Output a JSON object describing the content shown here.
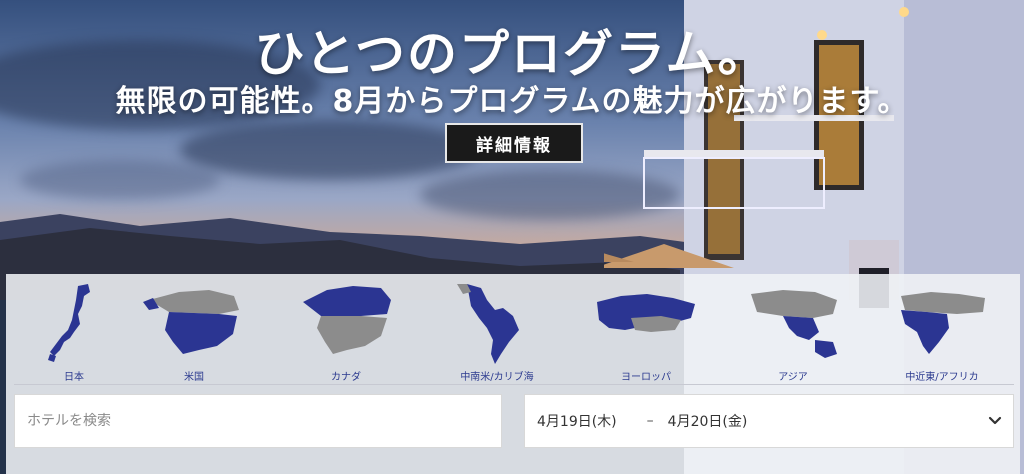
{
  "hero": {
    "headline": "ひとつのプログラム。",
    "subhead": "無限の可能性。8月からプログラムの魅力が広がります。",
    "more_button": "詳細情報"
  },
  "regions": [
    {
      "label": "日本",
      "icon": "japan-map-icon"
    },
    {
      "label": "米国",
      "icon": "usa-map-icon"
    },
    {
      "label": "カナダ",
      "icon": "canada-map-icon"
    },
    {
      "label": "中南米/カリブ海",
      "icon": "latin-america-map-icon"
    },
    {
      "label": "ヨーロッパ",
      "icon": "europe-map-icon"
    },
    {
      "label": "アジア",
      "icon": "asia-map-icon"
    },
    {
      "label": "中近東/アフリカ",
      "icon": "middle-east-africa-map-icon"
    }
  ],
  "search": {
    "placeholder": "ホテルを検索"
  },
  "dates": {
    "checkin": "4月19日(木)",
    "separator": "–",
    "checkout": "4月20日(金)"
  },
  "colors": {
    "region_fill": "#2b3592",
    "region_base": "#8c8c8c",
    "button_bg": "#1a1a1a"
  }
}
